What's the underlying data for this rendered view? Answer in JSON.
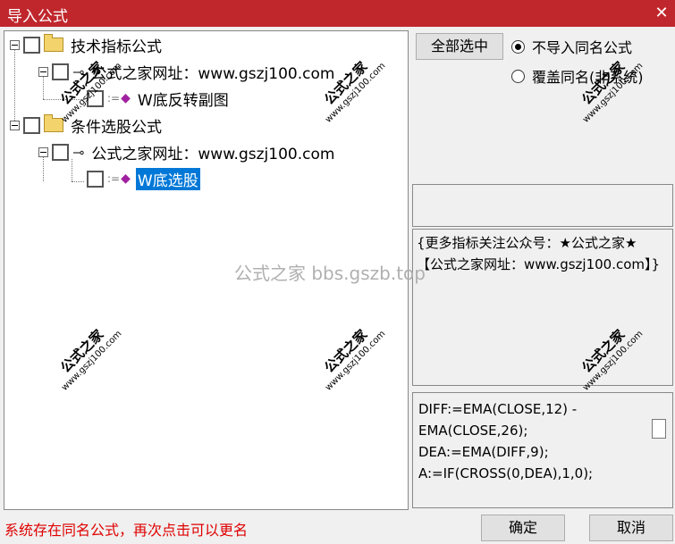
{
  "window": {
    "title": "导入公式",
    "close_glyph": "✕"
  },
  "tree": {
    "group1": {
      "label": "技术指标公式"
    },
    "site1": {
      "label": "公式之家网址：www.gszj100.com"
    },
    "item1": {
      "label": "W底反转副图"
    },
    "group2": {
      "label": "条件选股公式"
    },
    "site2": {
      "label": "公式之家网址：www.gszj100.com"
    },
    "item2": {
      "label": "W底选股"
    }
  },
  "buttons": {
    "select_all": "全部选中",
    "ok": "确定",
    "cancel": "取消"
  },
  "options": {
    "no_import": "不导入同名公式",
    "overwrite": "覆盖同名(非系统)",
    "selected": "no_import"
  },
  "description": "{更多指标关注公众号：★公式之家★ 【公式之家网址：www.gszj100.com】}",
  "code": "DIFF:=EMA(CLOSE,12) -\nEMA(CLOSE,26);\nDEA:=EMA(DIFF,9);\nA:=IF(CROSS(0,DEA),1,0);",
  "status": "系统存在同名公式，再次点击可以更名",
  "watermark": {
    "center": "公式之家 bbs.gszb.top",
    "stamp_top": "公式之家",
    "stamp_bottom": "www.gszj100.com"
  }
}
